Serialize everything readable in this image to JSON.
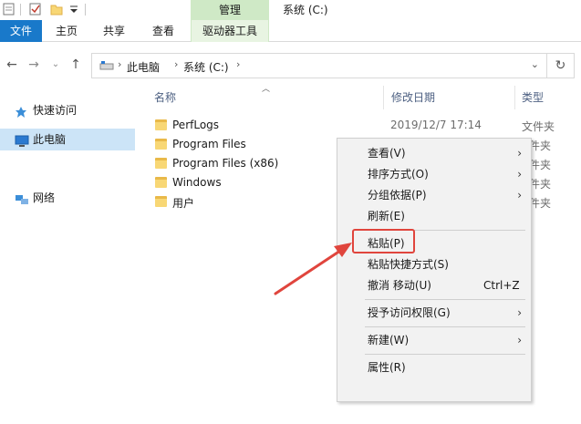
{
  "window": {
    "manage_tab": "管理",
    "title": "系统 (C:)"
  },
  "ribbon": {
    "tabs": [
      {
        "label": "文件"
      },
      {
        "label": "主页"
      },
      {
        "label": "共享"
      },
      {
        "label": "查看"
      },
      {
        "label": "驱动器工具"
      }
    ]
  },
  "address": {
    "crumbs": [
      "此电脑",
      "系统 (C:)"
    ]
  },
  "sidebar": {
    "items": [
      {
        "label": "快速访问",
        "icon": "pin-icon"
      },
      {
        "label": "此电脑",
        "icon": "computer-icon",
        "selected": true
      },
      {
        "label": "网络",
        "icon": "network-icon"
      }
    ]
  },
  "content": {
    "headers": {
      "name": "名称",
      "date": "修改日期",
      "type": "类型"
    },
    "rows": [
      {
        "name": "PerfLogs",
        "date": "2019/12/7 17:14",
        "type": "文件夹"
      },
      {
        "name": "Program Files",
        "date": "",
        "type": "件夹"
      },
      {
        "name": "Program Files (x86)",
        "date": "",
        "type": "件夹"
      },
      {
        "name": "Windows",
        "date": "",
        "type": "件夹"
      },
      {
        "name": "用户",
        "date": "",
        "type": "件夹"
      }
    ]
  },
  "context_menu": {
    "items": [
      {
        "label": "查看(V)",
        "submenu": true
      },
      {
        "label": "排序方式(O)",
        "submenu": true
      },
      {
        "label": "分组依据(P)",
        "submenu": true
      },
      {
        "label": "刷新(E)"
      },
      {
        "label": "粘贴(P)"
      },
      {
        "label": "粘贴快捷方式(S)"
      },
      {
        "label": "撤消 移动(U)",
        "shortcut": "Ctrl+Z"
      },
      {
        "label": "授予访问权限(G)",
        "submenu": true
      },
      {
        "label": "新建(W)",
        "submenu": true
      },
      {
        "label": "属性(R)"
      }
    ]
  },
  "colors": {
    "file_tab": "#1979ca",
    "manage_tab": "#cfe9c6",
    "selection": "#cce4f7",
    "annotation_red": "#e0453d",
    "folder": "#f8d775"
  }
}
